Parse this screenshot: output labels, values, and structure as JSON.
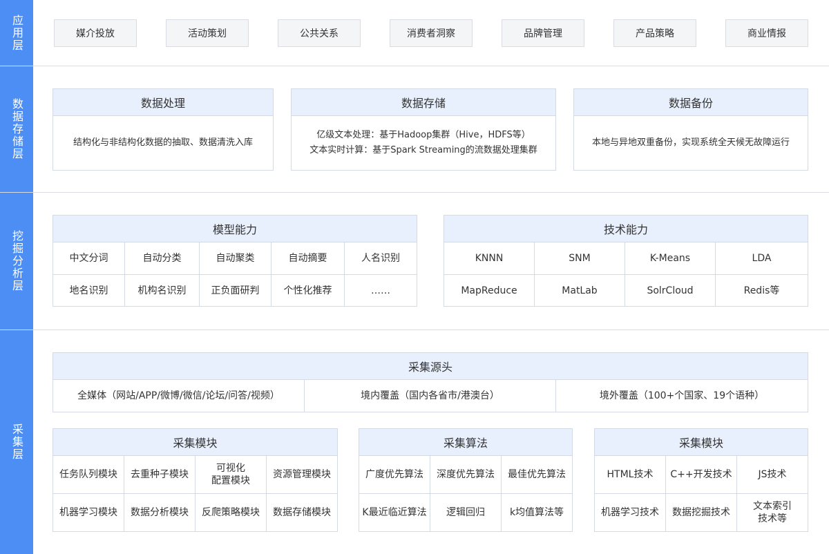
{
  "layers": {
    "app": "应用层",
    "storage": "数据存储层",
    "analysis": "挖掘分析层",
    "collect": "采集层"
  },
  "app_items": [
    "媒介投放",
    "活动策划",
    "公共关系",
    "消费者洞察",
    "品牌管理",
    "产品策略",
    "商业情报"
  ],
  "storage_cards": [
    {
      "title": "数据处理",
      "lines": [
        "结构化与非结构化数据的抽取、数据清洗入库"
      ]
    },
    {
      "title": "数据存储",
      "lines": [
        "亿级文本处理：基于Hadoop集群（Hive，HDFS等）",
        "文本实时计算：基于Spark Streaming的流数据处理集群"
      ]
    },
    {
      "title": "数据备份",
      "lines": [
        "本地与异地双重备份，实现系统全天候无故障运行"
      ]
    }
  ],
  "model": {
    "title": "模型能力",
    "cells": [
      "中文分词",
      "自动分类",
      "自动聚类",
      "自动摘要",
      "人名识别",
      "地名识别",
      "机构名识别",
      "正负面研判",
      "个性化推荐",
      "……"
    ]
  },
  "tech": {
    "title": "技术能力",
    "cells": [
      "KNNN",
      "SNM",
      "K-Means",
      "LDA",
      "MapReduce",
      "MatLab",
      "SolrCloud",
      "Redis等"
    ]
  },
  "source": {
    "title": "采集源头",
    "cells": [
      "全媒体（网站/APP/微博/微信/论坛/问答/视频）",
      "境内覆盖（国内各省市/港澳台）",
      "境外覆盖（100+个国家、19个语种）"
    ]
  },
  "collect_cards": [
    {
      "title": "采集模块",
      "cells": [
        "任务队列模块",
        "去重种子模块",
        "可视化\n配置模块",
        "资源管理模块",
        "机器学习模块",
        "数据分析模块",
        "反爬策略模块",
        "数据存储模块"
      ]
    },
    {
      "title": "采集算法",
      "cells": [
        "广度优先算法",
        "深度优先算法",
        "最佳优先算法",
        "K最近临近算法",
        "逻辑回归",
        "k均值算法等"
      ]
    },
    {
      "title": "采集模块",
      "cells": [
        "HTML技术",
        "C++开发技术",
        "JS技术",
        "机器学习技术",
        "数据挖掘技术",
        "文本索引\n技术等"
      ]
    }
  ]
}
